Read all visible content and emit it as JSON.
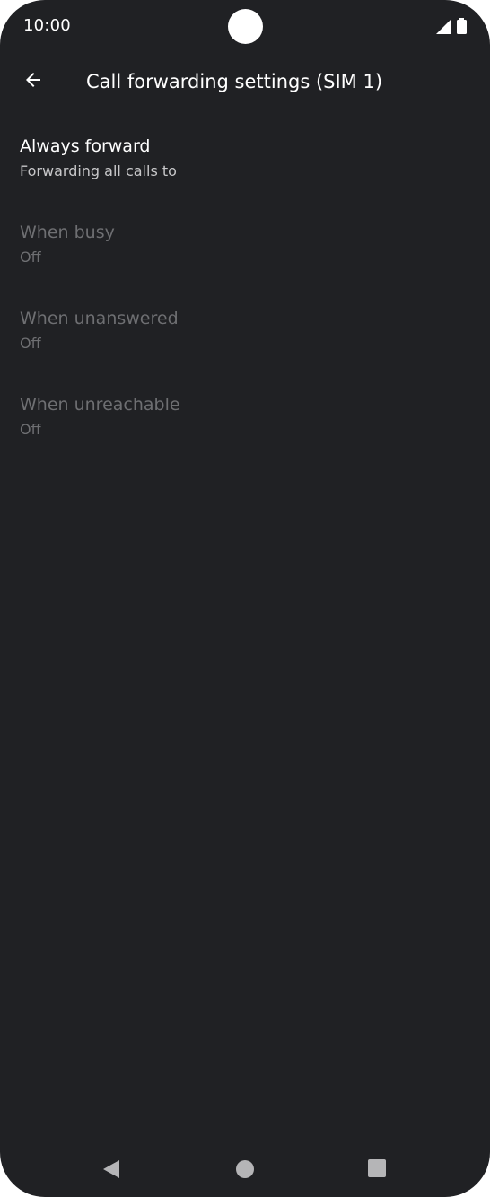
{
  "status_bar": {
    "time": "10:00",
    "icons": [
      "signal-icon",
      "battery-icon"
    ]
  },
  "app_bar": {
    "back_icon": "arrow-back-icon",
    "title": "Call forwarding settings (SIM 1)"
  },
  "settings": [
    {
      "title": "Always forward",
      "summary": "Forwarding all calls to",
      "enabled": true
    },
    {
      "title": "When busy",
      "summary": "Off",
      "enabled": false
    },
    {
      "title": "When unanswered",
      "summary": "Off",
      "enabled": false
    },
    {
      "title": "When unreachable",
      "summary": "Off",
      "enabled": false
    }
  ],
  "nav_bar": {
    "icons": [
      "nav-back-icon",
      "nav-home-icon",
      "nav-recents-icon"
    ]
  },
  "colors": {
    "background": "#202124",
    "text_primary": "#ffffff",
    "text_secondary": "#c7c7c9",
    "text_disabled": "#6e6f72"
  }
}
